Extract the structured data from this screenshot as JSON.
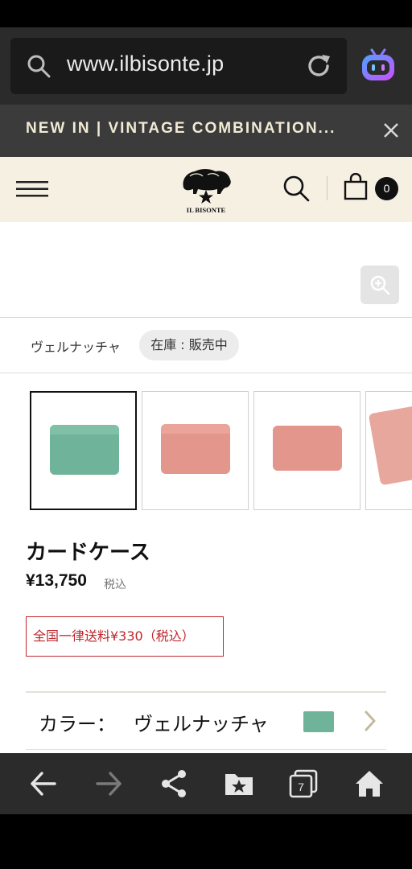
{
  "browser": {
    "url": "www.ilbisonte.jp",
    "tab_count": "7"
  },
  "banner": {
    "text": "NEW IN | VINTAGE COMBINATION..."
  },
  "header": {
    "logo_text": "IL BISONTE",
    "cart_count": "0"
  },
  "product": {
    "selected_color": "ヴェルナッチャ",
    "stock_status": "在庫 : 販売中",
    "title": "カードケース",
    "price": "¥13,750",
    "tax_note": "税込",
    "shipping_note": "全国一律送料¥330（税込）",
    "color_label": "カラー：",
    "color_value": "ヴェルナッチャ",
    "swatch_color": "#6fb39a",
    "thumbnail_colors": [
      "#6fb39a",
      "#e3968b",
      "#e3968b",
      "#e8a79c"
    ]
  },
  "colors": {
    "accent_red": "#c0262d",
    "header_bg": "#f6f0e3",
    "banner_text": "#f1ead5"
  }
}
